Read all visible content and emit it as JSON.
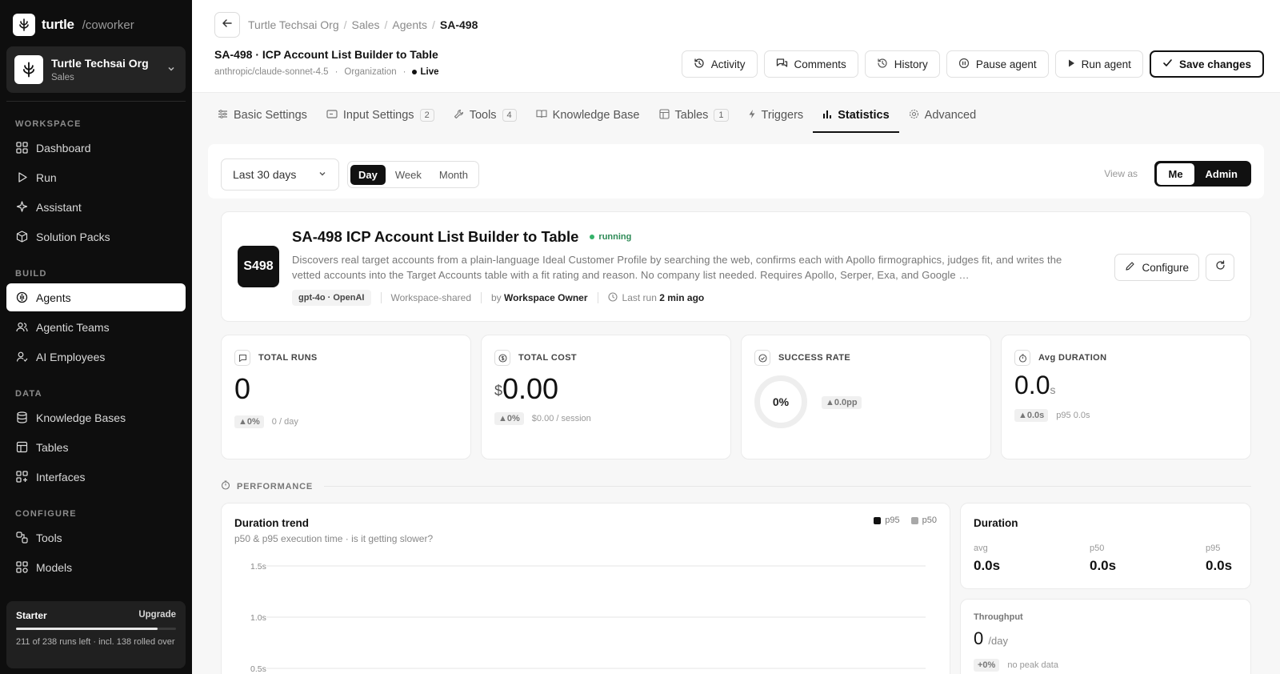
{
  "brand": {
    "name": "turtle",
    "product": "/coworker"
  },
  "org": {
    "name": "Turtle Techsai Org",
    "team": "Sales"
  },
  "sidebar": {
    "sections": {
      "workspace": "WORKSPACE",
      "build": "BUILD",
      "data": "DATA",
      "configure": "CONFIGURE"
    },
    "items": [
      {
        "label": "Dashboard",
        "icon": "grid-icon"
      },
      {
        "label": "Run",
        "icon": "play-icon"
      },
      {
        "label": "Assistant",
        "icon": "sparkle-icon"
      },
      {
        "label": "Solution Packs",
        "icon": "package-icon"
      },
      {
        "label": "Agents",
        "icon": "agent-icon"
      },
      {
        "label": "Agentic Teams",
        "icon": "users-icon"
      },
      {
        "label": "AI Employees",
        "icon": "user-icon"
      },
      {
        "label": "Knowledge Bases",
        "icon": "database-icon"
      },
      {
        "label": "Tables",
        "icon": "table-icon"
      },
      {
        "label": "Interfaces",
        "icon": "layout-icon"
      },
      {
        "label": "Tools",
        "icon": "tools-icon"
      },
      {
        "label": "Models",
        "icon": "models-icon"
      }
    ],
    "active": "Agents"
  },
  "plan": {
    "name": "Starter",
    "upgrade": "Upgrade",
    "usage_fraction": 0.886,
    "desc": "211 of 238 runs left · incl. 138 rolled over"
  },
  "breadcrumb": [
    "Turtle Techsai Org",
    "Sales",
    "Agents",
    "SA-498"
  ],
  "header": {
    "title": "SA-498 · ICP Account List Builder to Table",
    "model": "anthropic/claude-sonnet-4.5",
    "scope": "Organization",
    "status": "Live"
  },
  "actions": {
    "activity": "Activity",
    "comments": "Comments",
    "history": "History",
    "pause": "Pause agent",
    "run": "Run agent",
    "save": "Save changes"
  },
  "tabs": [
    {
      "label": "Basic Settings",
      "badge": ""
    },
    {
      "label": "Input Settings",
      "badge": "2"
    },
    {
      "label": "Tools",
      "badge": "4"
    },
    {
      "label": "Knowledge Base",
      "badge": ""
    },
    {
      "label": "Tables",
      "badge": "1"
    },
    {
      "label": "Triggers",
      "badge": ""
    },
    {
      "label": "Statistics",
      "badge": ""
    },
    {
      "label": "Advanced",
      "badge": ""
    }
  ],
  "filters": {
    "range": "Last 30 days",
    "granularity": [
      "Day",
      "Week",
      "Month"
    ],
    "granularity_selected": "Day",
    "view_as_label": "View as",
    "view_as": [
      "Me",
      "Admin"
    ],
    "view_as_selected": "Me"
  },
  "agent_card": {
    "avatar": "S498",
    "name": "SA-498 ICP Account List Builder to Table",
    "status": "running",
    "description": "Discovers real target accounts from a plain-language Ideal Customer Profile by searching the web, confirms each with Apollo firmographics, judges fit, and writes the vetted accounts into the Target Accounts table with a fit rating and reason. No company list needed. Requires Apollo, Serper, Exa, and Google …",
    "model_chip": "gpt-4o · OpenAI",
    "sharing": "Workspace-shared",
    "by_label": "by",
    "owner": "Workspace Owner",
    "last_run_label": "Last run",
    "last_run": "2 min ago",
    "configure": "Configure"
  },
  "stats": {
    "total_runs": {
      "label": "TOTAL RUNS",
      "value": "0",
      "delta": "▲0%",
      "sub": "0 / day"
    },
    "total_cost": {
      "label": "TOTAL COST",
      "currency": "$",
      "value": "0.00",
      "delta": "▲0%",
      "sub": "$0.00 / session"
    },
    "success_rate": {
      "label": "SUCCESS RATE",
      "value": "0%",
      "delta": "▲0.0pp"
    },
    "avg_duration": {
      "label": "Avg DURATION",
      "value": "0.0",
      "unit": "s",
      "delta": "▲0.0s",
      "sub": "p95 0.0s"
    }
  },
  "performance": {
    "section": "PERFORMANCE",
    "trend": {
      "title": "Duration trend",
      "subtitle": "p50 & p95 execution time · is it getting slower?"
    },
    "duration": {
      "title": "Duration",
      "avg_label": "avg",
      "avg": "0.0s",
      "p50_label": "p50",
      "p50": "0.0s",
      "p95_label": "p95",
      "p95": "0.0s"
    },
    "throughput": {
      "title": "Throughput",
      "value": "0",
      "unit": "/day",
      "delta": "+0%",
      "sub": "no peak data"
    }
  },
  "chart_data": {
    "type": "line",
    "title": "Duration trend",
    "subtitle": "p50 & p95 execution time · is it getting slower?",
    "xlabel": "",
    "ylabel": "",
    "y_ticks": [
      "1.5s",
      "1.0s",
      "0.5s"
    ],
    "ylim": [
      0,
      1.5
    ],
    "grid": true,
    "legend_position": "top-right",
    "series": [
      {
        "name": "p95",
        "values": [],
        "color": "#111111"
      },
      {
        "name": "p50",
        "values": [],
        "color": "#a8a8a8"
      }
    ]
  }
}
